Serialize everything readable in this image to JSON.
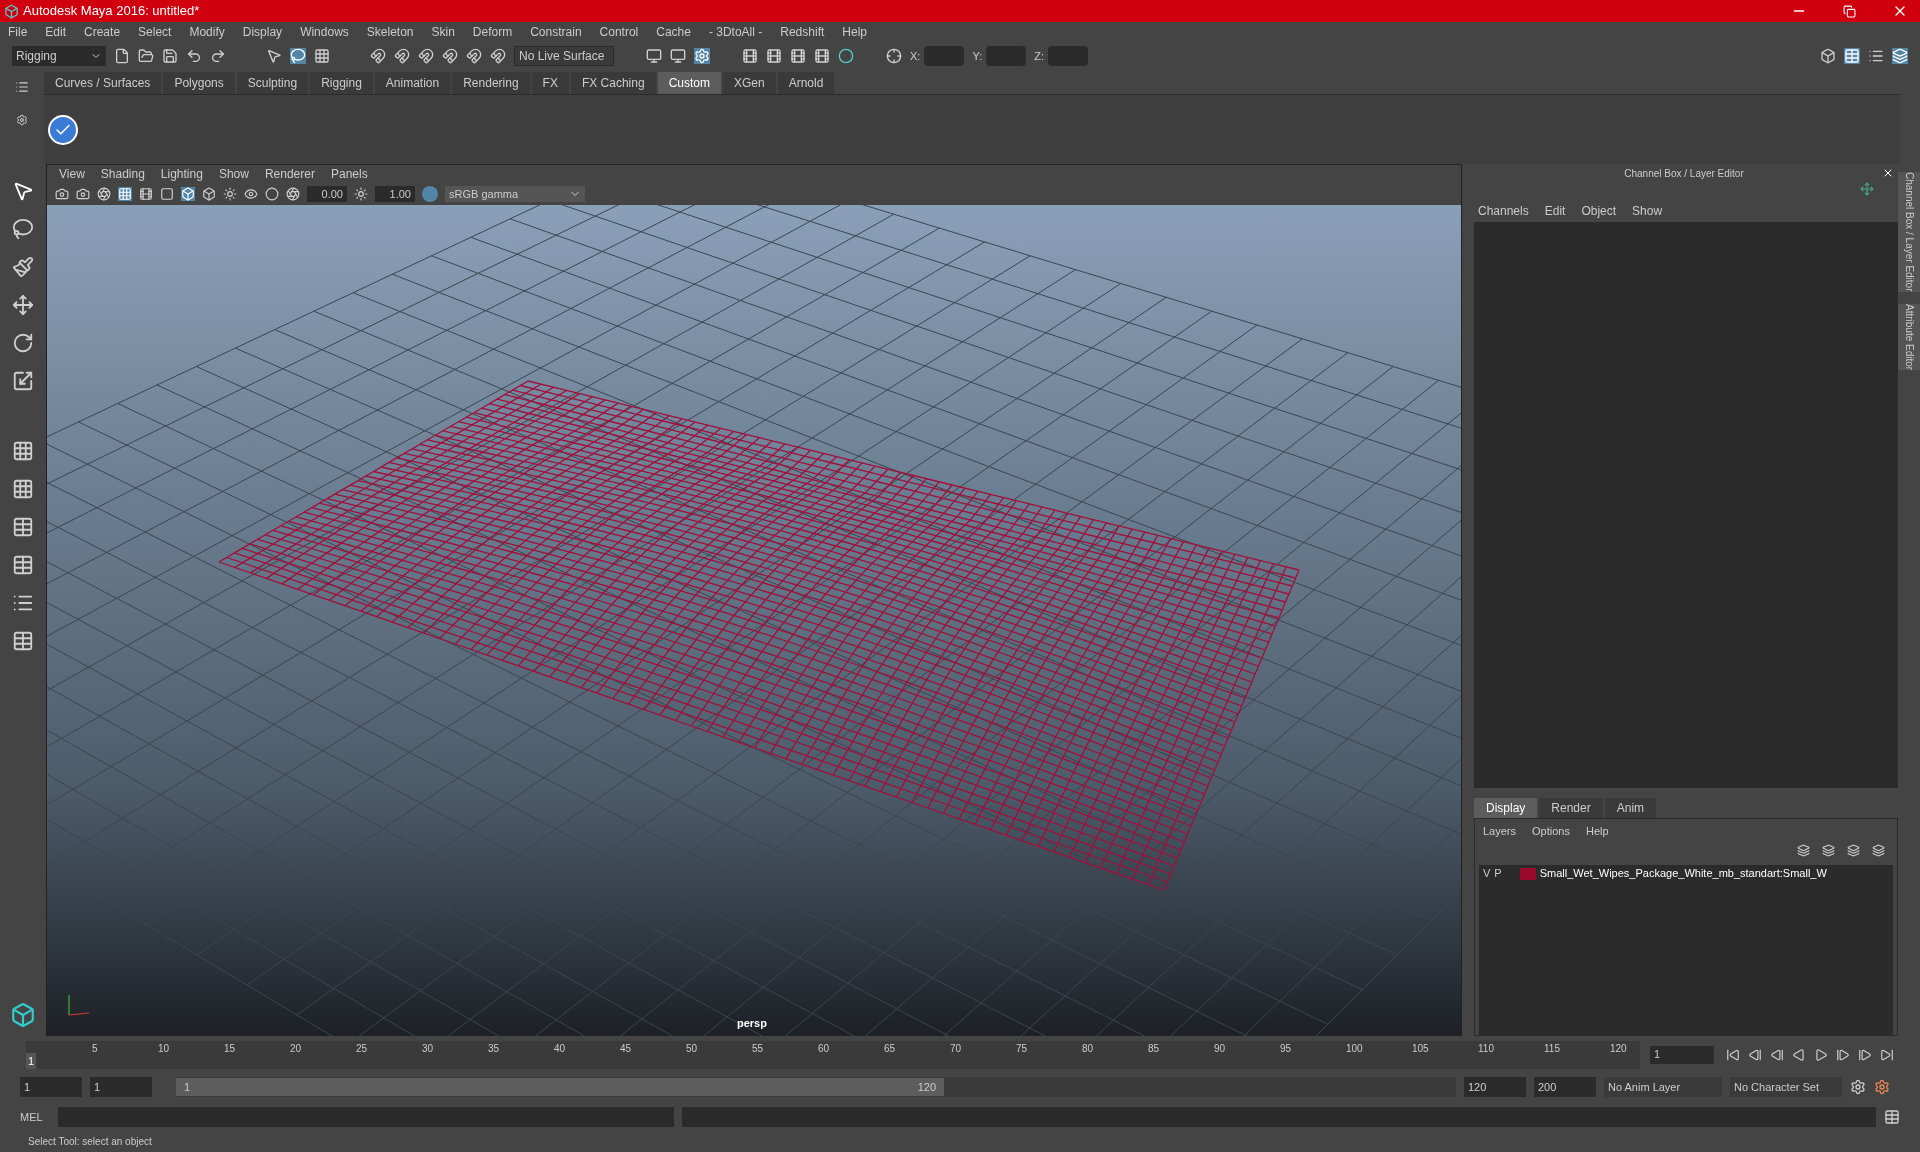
{
  "window": {
    "title": "Autodesk Maya 2016: untitled*"
  },
  "menu_bar": [
    "File",
    "Edit",
    "Create",
    "Select",
    "Modify",
    "Display",
    "Windows",
    "Skeleton",
    "Skin",
    "Deform",
    "Constrain",
    "Control",
    "Cache",
    "- 3DtoAll -",
    "Redshift",
    "Help"
  ],
  "status_line": {
    "mode": "Rigging",
    "live_surface": "No Live Surface",
    "coord_labels": [
      "X:",
      "Y:",
      "Z:"
    ]
  },
  "shelf_tabs": [
    {
      "label": "Curves / Surfaces",
      "selected": false
    },
    {
      "label": "Polygons",
      "selected": false
    },
    {
      "label": "Sculpting",
      "selected": false
    },
    {
      "label": "Rigging",
      "selected": false
    },
    {
      "label": "Animation",
      "selected": false
    },
    {
      "label": "Rendering",
      "selected": false
    },
    {
      "label": "FX",
      "selected": false
    },
    {
      "label": "FX Caching",
      "selected": false
    },
    {
      "label": "Custom",
      "selected": true
    },
    {
      "label": "XGen",
      "selected": false
    },
    {
      "label": "Arnold",
      "selected": false
    }
  ],
  "viewport": {
    "menus": [
      "View",
      "Shading",
      "Lighting",
      "Show",
      "Renderer",
      "Panels"
    ],
    "exposure": "0.00",
    "gamma": "1.00",
    "color_space": "sRGB gamma",
    "camera": "persp"
  },
  "channel_box": {
    "title": "Channel Box / Layer Editor",
    "menus": [
      "Channels",
      "Edit",
      "Object",
      "Show"
    ]
  },
  "side_tabs": [
    "Channel Box / Layer Editor",
    "Attribute Editor"
  ],
  "layer_editor": {
    "tabs": [
      {
        "label": "Display",
        "selected": true
      },
      {
        "label": "Render",
        "selected": false
      },
      {
        "label": "Anim",
        "selected": false
      }
    ],
    "menus": [
      "Layers",
      "Options",
      "Help"
    ],
    "layers": [
      {
        "visible": "V",
        "playback": "P",
        "color": "#9b0a2c",
        "name": "Small_Wet_Wipes_Package_White_mb_standart:Small_W"
      }
    ]
  },
  "timeline": {
    "ticks": [
      "5",
      "10",
      "15",
      "20",
      "25",
      "30",
      "35",
      "40",
      "45",
      "50",
      "55",
      "60",
      "65",
      "70",
      "75",
      "80",
      "85",
      "90",
      "95",
      "100",
      "105",
      "110",
      "115",
      "120"
    ],
    "current": "1",
    "level": 0,
    "frame_field": "1"
  },
  "range": {
    "start": "1",
    "playback_start": "1",
    "slider_start": "1",
    "slider_end": "120",
    "level": 0.6,
    "playback_end": "120",
    "end": "200",
    "anim_layer": "No Anim Layer",
    "character_set": "No Character Set"
  },
  "command_line": {
    "label": "MEL"
  },
  "help_line": "Select Tool: select an object"
}
